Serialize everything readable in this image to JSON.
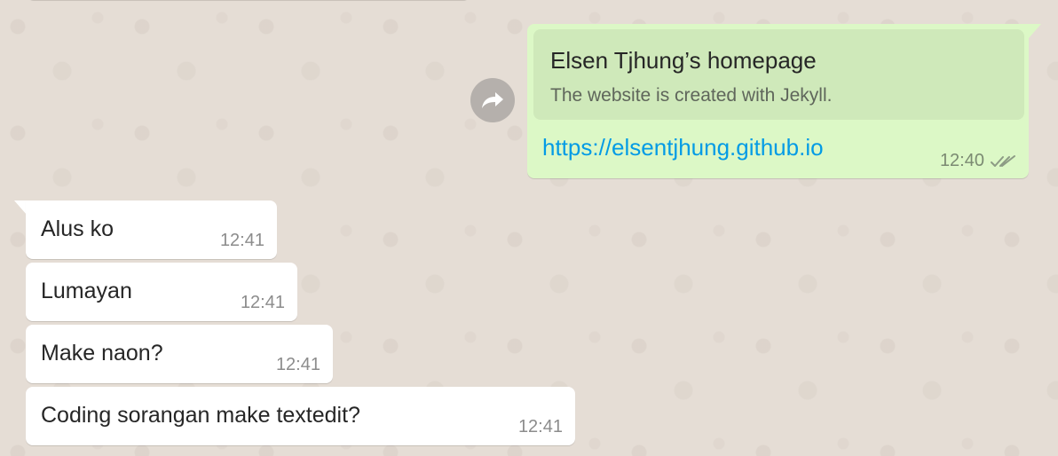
{
  "outgoing": {
    "preview_title": "Elsen Tjhung’s homepage",
    "preview_description": "The website is created with Jekyll.",
    "link": "https://elsentjhung.github.io",
    "time": "12:40",
    "status_icon": "double-check-icon"
  },
  "forward": {
    "icon": "forward-icon"
  },
  "incoming": [
    {
      "text": "Alus ko",
      "time": "12:41"
    },
    {
      "text": "Lumayan",
      "time": "12:41"
    },
    {
      "text": "Make naon?",
      "time": "12:41"
    },
    {
      "text": "Coding sorangan make textedit?",
      "time": "12:41"
    }
  ],
  "colors": {
    "chat_background": "#e5ddd5",
    "outgoing_bubble": "#dcf8c6",
    "link_preview": "#cfe9ba",
    "incoming_bubble": "#ffffff",
    "link": "#039be5"
  }
}
